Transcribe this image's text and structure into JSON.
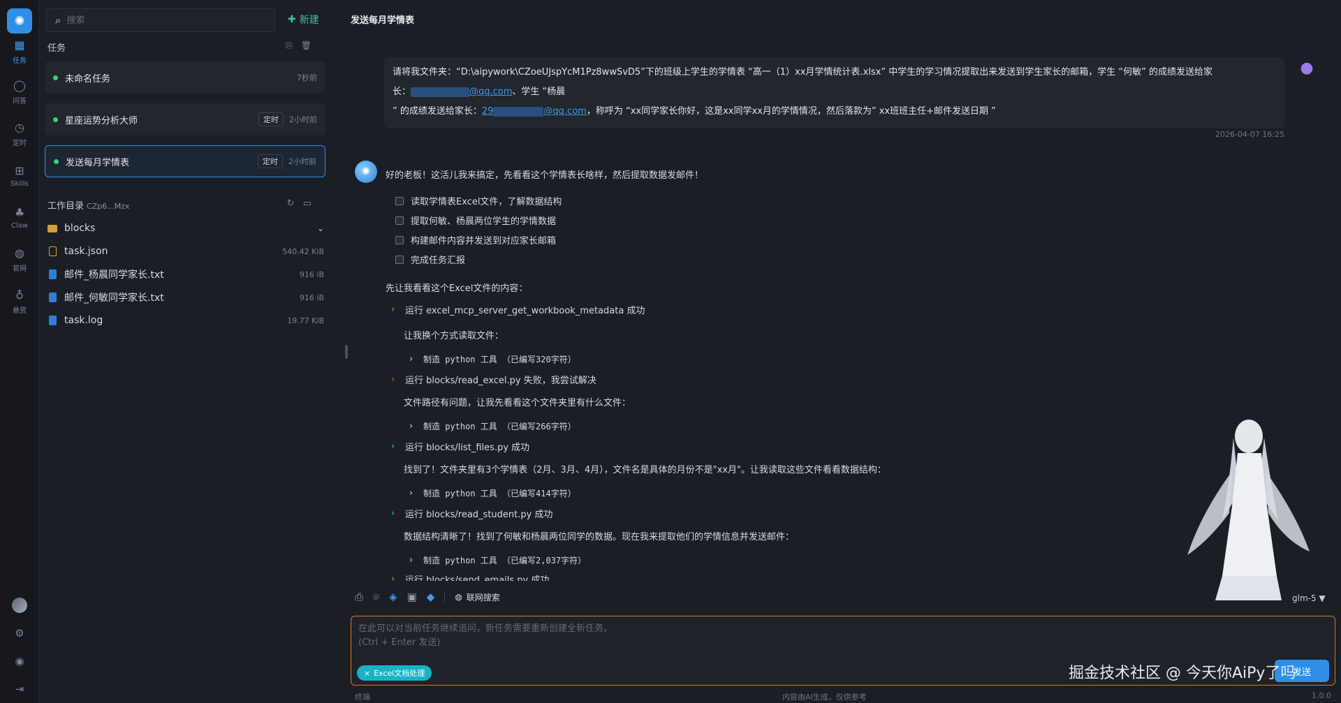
{
  "rail": {
    "items": [
      {
        "label": "任务",
        "icon": "tasks-icon"
      },
      {
        "label": "问答",
        "icon": "chat-icon"
      },
      {
        "label": "定时",
        "icon": "schedule-icon"
      },
      {
        "label": "Skills",
        "icon": "skills-icon"
      },
      {
        "label": "Claw",
        "icon": "claw-icon"
      },
      {
        "label": "官网",
        "icon": "globe-icon"
      },
      {
        "label": "悬赏",
        "icon": "bounty-icon"
      }
    ]
  },
  "search": {
    "placeholder": "搜索"
  },
  "new_button": "新建",
  "tasks_section": {
    "title": "任务",
    "items": [
      {
        "name": "未命名任务",
        "badge": "",
        "time": "7秒前"
      },
      {
        "name": "星座运势分析大师",
        "badge": "定时",
        "time": "2小时前"
      },
      {
        "name": "发送每月学情表",
        "badge": "定时",
        "time": "2小时前"
      }
    ]
  },
  "workdir": {
    "title": "工作目录",
    "id": "CZp6...Mzx",
    "files": [
      {
        "name": "blocks",
        "size": "",
        "type": "folder"
      },
      {
        "name": "task.json",
        "size": "540.42 KiB",
        "type": "json"
      },
      {
        "name": "邮件_杨晨同学家长.txt",
        "size": "916 iB",
        "type": "txt"
      },
      {
        "name": "邮件_何敏同学家长.txt",
        "size": "916 iB",
        "type": "txt"
      },
      {
        "name": "task.log",
        "size": "19.77 KiB",
        "type": "txt"
      }
    ]
  },
  "main": {
    "title": "发送每月学情表",
    "user_message": {
      "line1": "请将我文件夹：“D:\\aipywork\\CZoeUJspYcM1Pz8wwSvD5”下的班级上学生的学情表 “高一（1）xx月学情统计表.xlsx” 中学生的学习情况提取出来发送到学生家长的邮箱，学生 “何敏” 的成绩发送给家",
      "line2_prefix": "长：",
      "email1_suffix": "@qq.com",
      "line2_mid": "、学生 “杨晨",
      "line3_prefix": "” 的成绩发送给家长：",
      "email2_prefix": "29",
      "email2_suffix": "@qq.com",
      "line3_suffix": "，称呼为 “xx同学家长你好，这是xx同学xx月的学情情况，然后落款为” xx班班主任+邮件发送日期 ”",
      "time": "2026-04-07 16:25"
    },
    "ai_intro": "好的老板！这活儿我来搞定，先看看这个学情表长啥样，然后提取数据发邮件！",
    "checklist": [
      "读取学情表Excel文件，了解数据结构",
      "提取何敏、杨晨两位学生的学情数据",
      "构建邮件内容并发送到对应家长邮箱",
      "完成任务汇报"
    ],
    "look_line": "先让我看看这个Excel文件的内容：",
    "steps": [
      {
        "text": "运行 excel_mcp_server_get_workbook_metadata 成功",
        "status": "ok"
      },
      {
        "text": "让我换个方式读取文件：",
        "status": "note"
      },
      {
        "text": "制造 python 工具 （已编写320字符）",
        "status": "tool"
      },
      {
        "text": "运行 blocks/read_excel.py 失败，我尝试解决",
        "status": "fail"
      },
      {
        "text": "文件路径有问题，让我先看看这个文件夹里有什么文件：",
        "status": "note"
      },
      {
        "text": "制造 python 工具 （已编写266字符）",
        "status": "tool"
      },
      {
        "text": "运行 blocks/list_files.py 成功",
        "status": "ok"
      },
      {
        "text": "找到了！文件夹里有3个学情表（2月、3月、4月），文件名是具体的月份不是\"xx月\"。让我读取这些文件看看数据结构：",
        "status": "note"
      },
      {
        "text": "制造 python 工具 （已编写414字符）",
        "status": "tool"
      },
      {
        "text": "运行 blocks/read_student.py 成功",
        "status": "ok"
      },
      {
        "text": "数据结构清晰了！找到了何敏和杨晨两位同学的数据。现在我来提取他们的学情信息并发送邮件：",
        "status": "note"
      },
      {
        "text": "制造 python 工具 （已编写2,037字符）",
        "status": "tool"
      },
      {
        "text": "运行 blocks/send_emails.py 成功",
        "status": "ok"
      }
    ]
  },
  "toolbar": {
    "web_search": "联网搜索",
    "model": "glm-5 ▼"
  },
  "input": {
    "placeholder": "在此可以对当前任务继续追问，新任务需要重新创建全新任务。\n(Ctrl + Enter 发送)",
    "tag": "Excel文档处理",
    "send": "发送"
  },
  "watermark": "掘金技术社区 @ 今天你AiPy了吗",
  "footer": {
    "left": "终端",
    "mid": "内容由AI生成，仅供参考",
    "right": "1.0.0"
  },
  "colors": {
    "accent": "#2f8fe6",
    "success": "#3ecf7a",
    "fail": "#e0504f",
    "new": "#3ec1a0",
    "input_border": "#d67a2e",
    "tag": "#19b3c7"
  }
}
